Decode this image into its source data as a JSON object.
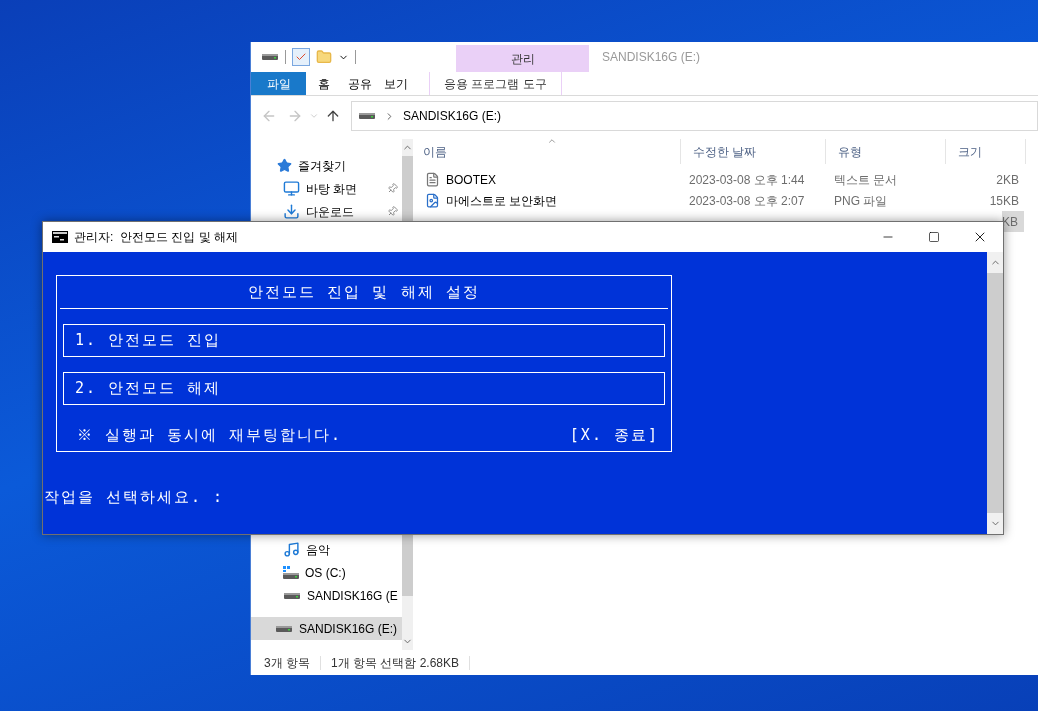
{
  "explorer": {
    "title": "SANDISK16G (E:)",
    "context_group": "관리",
    "ribbon_tabs": [
      {
        "label": "파일",
        "selected": true,
        "kind": "file"
      },
      {
        "label": "홈",
        "selected": false,
        "kind": "tab"
      },
      {
        "label": "공유",
        "selected": false,
        "kind": "tab"
      },
      {
        "label": "보기",
        "selected": false,
        "kind": "tab"
      },
      {
        "label": "응용 프로그램 도구",
        "selected": false,
        "kind": "contextual"
      }
    ],
    "address": "SANDISK16G (E:)",
    "sidebar_top": [
      {
        "label": "즐겨찾기",
        "kind": "favorites",
        "pinned": false,
        "selected": false
      },
      {
        "label": "바탕 화면",
        "kind": "desktop",
        "pinned": true,
        "selected": false
      },
      {
        "label": "다운로드",
        "kind": "downloads",
        "pinned": true,
        "selected": false
      }
    ],
    "sidebar_bottom": [
      {
        "label": "음악",
        "kind": "music",
        "pinned": false,
        "selected": false
      },
      {
        "label": "OS (C:)",
        "kind": "system-drive",
        "pinned": false,
        "selected": false
      },
      {
        "label": "SANDISK16G (E",
        "kind": "drive",
        "pinned": false,
        "selected": false
      },
      {
        "label": "SANDISK16G (E:)",
        "kind": "root-drive",
        "pinned": false,
        "selected": true
      }
    ],
    "columns": [
      "이름",
      "수정한 날짜",
      "유형",
      "크기"
    ],
    "rows": [
      {
        "name": "BOOTEX",
        "modified": "2023-03-08 오후 1:44",
        "type": "텍스트 문서",
        "size": "2KB",
        "kind": "text",
        "selected": false
      },
      {
        "name": "마에스트로 보안화면",
        "modified": "2023-03-08 오후 2:07",
        "type": "PNG 파일",
        "size": "15KB",
        "kind": "image",
        "selected": false
      },
      {
        "size": "KB",
        "selected": true
      }
    ],
    "status_bar": {
      "item_count": "3개 항목",
      "selection": "1개 항목 선택함 2.68KB"
    }
  },
  "console": {
    "title": "관리자:  안전모드 진입 및 해제",
    "panel_title": "안전모드 진입 및 해제 설정",
    "options": [
      "1. 안전모드 진입",
      "2. 안전모드 해제"
    ],
    "note": "※ 실행과 동시에 재부팅합니다.",
    "exit": "[X. 종료]",
    "prompt": "작업을 선택하세요. :"
  }
}
